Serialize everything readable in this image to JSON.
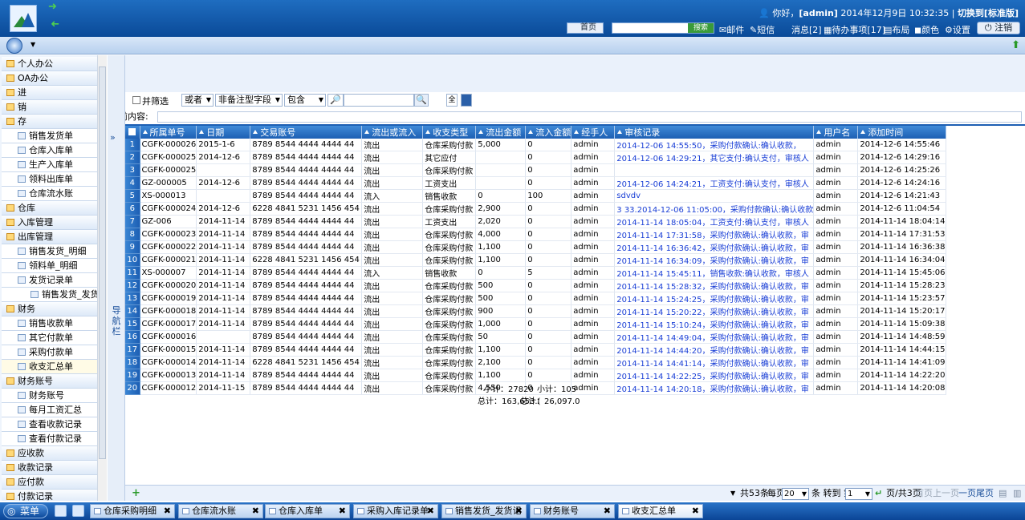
{
  "header": {
    "greeting_prefix": "你好，",
    "user": "[admin]",
    "date": "2014年12月9日",
    "time": "10:32:35",
    "switch_label": "切换到[标准版]",
    "home_label": "首页",
    "search_go": "搜索",
    "mail": "邮件",
    "sms": "短信",
    "messages": "消息[2]",
    "todo": "待办事项[17]",
    "layout": "布局",
    "color": "颜色",
    "settings": "设置",
    "logout": "注销"
  },
  "sidebar": {
    "items": [
      {
        "label": "个人办公",
        "level": 0
      },
      {
        "label": "OA办公",
        "level": 0
      },
      {
        "label": "进",
        "level": 0
      },
      {
        "label": "销",
        "level": 0
      },
      {
        "label": "存",
        "level": 0
      },
      {
        "label": "销售发货单",
        "level": 1
      },
      {
        "label": "仓库入库单",
        "level": 1
      },
      {
        "label": "生产入库单",
        "level": 1
      },
      {
        "label": "领料出库单",
        "level": 1
      },
      {
        "label": "仓库流水账",
        "level": 1
      },
      {
        "label": "仓库",
        "level": 0
      },
      {
        "label": "入库管理",
        "level": 0
      },
      {
        "label": "出库管理",
        "level": 0
      },
      {
        "label": "销售发货_明细",
        "level": 1
      },
      {
        "label": "领料单_明细",
        "level": 1
      },
      {
        "label": "发货记录单",
        "level": 1
      },
      {
        "label": "销售发货_发货记",
        "level": 2
      },
      {
        "label": "财务",
        "level": 0
      },
      {
        "label": "销售收款单",
        "level": 1
      },
      {
        "label": "其它付款单",
        "level": 1
      },
      {
        "label": "采购付款单",
        "level": 1
      },
      {
        "label": "收支汇总单",
        "level": 1
      },
      {
        "label": "财务账号",
        "level": 0
      },
      {
        "label": "财务账号",
        "level": 1
      },
      {
        "label": "每月工资汇总",
        "level": 1
      },
      {
        "label": "查看收款记录",
        "level": 1
      },
      {
        "label": "查看付款记录",
        "level": 1
      },
      {
        "label": "应收款",
        "level": 0
      },
      {
        "label": "收款记录",
        "level": 0
      },
      {
        "label": "应付款",
        "level": 0
      },
      {
        "label": "付款记录",
        "level": 0
      }
    ]
  },
  "navtab": {
    "label": "导航栏",
    "expand": "»"
  },
  "filter": {
    "and_filter": "并筛选",
    "or": "或者",
    "field": "非备注型字段",
    "op": "包含",
    "value": "",
    "current_label": "当前内容:"
  },
  "grid": {
    "columns": [
      "所属单号",
      "日期",
      "交易账号",
      "流出或流入",
      "收支类型",
      "流出金额",
      "流入金额",
      "经手人",
      "审核记录",
      "用户名",
      "添加时间"
    ],
    "rows": [
      [
        "CGFK-000026",
        "2015-1-6",
        "8789 8544 4444 4444 44",
        "流出",
        "仓库采购付款",
        "5,000",
        "0",
        "admin",
        "2014-12-06 14:55:50，采购付款确认:确认收款，",
        "admin",
        "2014-12-6 14:55:46"
      ],
      [
        "CGFK-000025",
        "2014-12-6",
        "8789 8544 4444 4444 44",
        "流出",
        "其它应付",
        "",
        "0",
        "admin",
        "2014-12-06 14:29:21，其它支付:确认支付，审核人",
        "admin",
        "2014-12-6 14:29:16"
      ],
      [
        "CGFK-000025",
        "",
        "8789 8544 4444 4444 44",
        "流出",
        "仓库采购付款",
        "",
        "0",
        "admin",
        "",
        "admin",
        "2014-12-6 14:25:26"
      ],
      [
        "GZ-000005",
        "2014-12-6",
        "8789 8544 4444 4444 44",
        "流出",
        "工资支出",
        "",
        "0",
        "admin",
        "2014-12-06 14:24:21，工资支付:确认支付，审核人",
        "admin",
        "2014-12-6 14:24:16"
      ],
      [
        "XS-000013",
        "",
        "8789 8544 4444 4444 44",
        "流入",
        "销售收款",
        "0",
        "100",
        "admin",
        "sdvdv",
        "admin",
        "2014-12-6 14:21:43"
      ],
      [
        "CGFK-000024",
        "2014-12-6",
        "6228 4841 5231 1456 454",
        "流出",
        "仓库采购付款",
        "2,900",
        "0",
        "admin",
        "3 33.2014-12-06 11:05:00，采购付款确认:确认收款",
        "admin",
        "2014-12-6 11:04:54"
      ],
      [
        "GZ-006",
        "2014-11-14",
        "8789 8544 4444 4444 44",
        "流出",
        "工资支出",
        "2,020",
        "0",
        "admin",
        "2014-11-14 18:05:04，工资支付:确认支付，审核人",
        "admin",
        "2014-11-14 18:04:14"
      ],
      [
        "CGFK-000023",
        "2014-11-14",
        "8789 8544 4444 4444 44",
        "流出",
        "仓库采购付款",
        "4,000",
        "0",
        "admin",
        "2014-11-14 17:31:58，采购付款确认:确认收款，审",
        "admin",
        "2014-11-14 17:31:53"
      ],
      [
        "CGFK-000022",
        "2014-11-14",
        "8789 8544 4444 4444 44",
        "流出",
        "仓库采购付款",
        "1,100",
        "0",
        "admin",
        "2014-11-14 16:36:42，采购付款确认:确认收款，审",
        "admin",
        "2014-11-14 16:36:38"
      ],
      [
        "CGFK-000021",
        "2014-11-14",
        "6228 4841 5231 1456 454",
        "流出",
        "仓库采购付款",
        "1,100",
        "0",
        "admin",
        "2014-11-14 16:34:09，采购付款确认:确认收款，审",
        "admin",
        "2014-11-14 16:34:04"
      ],
      [
        "XS-000007",
        "2014-11-14",
        "8789 8544 4444 4444 44",
        "流入",
        "销售收款",
        "0",
        "5",
        "admin",
        "2014-11-14 15:45:11，销售收款:确认收款，审核人",
        "admin",
        "2014-11-14 15:45:06"
      ],
      [
        "CGFK-000020",
        "2014-11-14",
        "8789 8544 4444 4444 44",
        "流出",
        "仓库采购付款",
        "500",
        "0",
        "admin",
        "2014-11-14 15:28:32，采购付款确认:确认收款，审",
        "admin",
        "2014-11-14 15:28:23"
      ],
      [
        "CGFK-000019",
        "2014-11-14",
        "8789 8544 4444 4444 44",
        "流出",
        "仓库采购付款",
        "500",
        "0",
        "admin",
        "2014-11-14 15:24:25，采购付款确认:确认收款，审",
        "admin",
        "2014-11-14 15:23:57"
      ],
      [
        "CGFK-000018",
        "2014-11-14",
        "8789 8544 4444 4444 44",
        "流出",
        "仓库采购付款",
        "900",
        "0",
        "admin",
        "2014-11-14 15:20:22，采购付款确认:确认收款，审",
        "admin",
        "2014-11-14 15:20:17"
      ],
      [
        "CGFK-000017",
        "2014-11-14",
        "8789 8544 4444 4444 44",
        "流出",
        "仓库采购付款",
        "1,000",
        "0",
        "admin",
        "2014-11-14 15:10:24，采购付款确认:确认收款，审",
        "admin",
        "2014-11-14 15:09:38"
      ],
      [
        "CGFK-000016",
        "",
        "8789 8544 4444 4444 44",
        "流出",
        "仓库采购付款",
        "50",
        "0",
        "admin",
        "2014-11-14 14:49:04，采购付款确认:确认收款，审",
        "admin",
        "2014-11-14 14:48:59"
      ],
      [
        "CGFK-000015",
        "2014-11-14",
        "8789 8544 4444 4444 44",
        "流出",
        "仓库采购付款",
        "1,100",
        "0",
        "admin",
        "2014-11-14 14:44:20，采购付款确认:确认收款，审",
        "admin",
        "2014-11-14 14:44:15"
      ],
      [
        "CGFK-000014",
        "2014-11-14",
        "6228 4841 5231 1456 454",
        "流出",
        "仓库采购付款",
        "2,100",
        "0",
        "admin",
        "2014-11-14 14:41:14，采购付款确认:确认收款，审",
        "admin",
        "2014-11-14 14:41:09"
      ],
      [
        "CGFK-000013",
        "2014-11-14",
        "8789 8544 4444 4444 44",
        "流出",
        "仓库采购付款",
        "1,100",
        "0",
        "admin",
        "2014-11-14 14:22:25，采购付款确认:确认收款，审",
        "admin",
        "2014-11-14 14:22:20"
      ],
      [
        "CGFK-000012",
        "2014-11-15",
        "8789 8544 4444 4444 44",
        "流出",
        "仓库采购付款",
        "4,550",
        "0",
        "admin",
        "2014-11-14 14:20:18，采购付款确认:确认收款，审",
        "admin",
        "2014-11-14 14:20:08"
      ]
    ],
    "subtotal_out": "小计：27820",
    "subtotal_in": "小计：105",
    "total_out": "总计：163,653.(",
    "total_in": "总计：26,097.0"
  },
  "pager": {
    "total": "共53条",
    "per_page_label": "每页",
    "per_page": "20",
    "goto_label": "条 转到 第",
    "page": "1",
    "page_info": "页/共3页",
    "first": "首页",
    "prev": "上一页",
    "next": "一页",
    "last": "尾页",
    "add": "+"
  },
  "taskbar": {
    "start": "菜单",
    "tabs": [
      "仓库采购明细",
      "仓库流水账",
      "仓库入库单",
      "采购入库记录单",
      "销售发货_发货记",
      "财务账号",
      "收支汇总单"
    ],
    "close": "✖"
  }
}
